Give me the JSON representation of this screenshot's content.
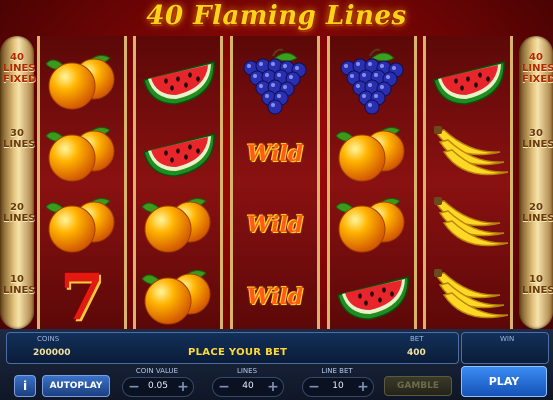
{
  "game": {
    "title": "40 Flaming Lines"
  },
  "side_left": [
    {
      "label": "40\nLINES\nFIXED",
      "active": true
    },
    {
      "label": "30\nLINES",
      "active": false
    },
    {
      "label": "20\nLINES",
      "active": false
    },
    {
      "label": "10\nLINES",
      "active": false
    }
  ],
  "side_right": [
    {
      "label": "40\nLINES\nFIXED",
      "active": true
    },
    {
      "label": "30\nLINES",
      "active": false
    },
    {
      "label": "20\nLINES",
      "active": false
    },
    {
      "label": "10\nLINES",
      "active": false
    }
  ],
  "reels": [
    [
      "orange",
      "orange",
      "orange",
      "seven"
    ],
    [
      "watermelon",
      "watermelon",
      "orange",
      "orange"
    ],
    [
      "grapes",
      "wild",
      "wild",
      "wild"
    ],
    [
      "grapes",
      "orange",
      "orange",
      "watermelon"
    ],
    [
      "watermelon",
      "banana",
      "banana",
      "banana"
    ]
  ],
  "symbols": {
    "wild_text": "Wild",
    "seven_text": "7"
  },
  "info": {
    "coins_label": "COINS",
    "coins_value": "200000",
    "message": "PLACE YOUR BET",
    "bet_label": "BET",
    "bet_value": "400",
    "win_label": "WIN",
    "win_value": ""
  },
  "controls": {
    "info_button": "i",
    "autoplay_button": "AUTOPLAY",
    "coin_value_label": "COIN VALUE",
    "coin_value": "0.05",
    "lines_label": "LINES",
    "lines_value": "40",
    "line_bet_label": "LINE BET",
    "line_bet_value": "10",
    "minus": "−",
    "plus": "+",
    "gamble_button": "GAMBLE",
    "play_button": "PLAY"
  },
  "colors": {
    "accent_gold": "#ffd21a",
    "panel_blue": "#1e2b44",
    "play_blue": "#1f6fe0"
  }
}
